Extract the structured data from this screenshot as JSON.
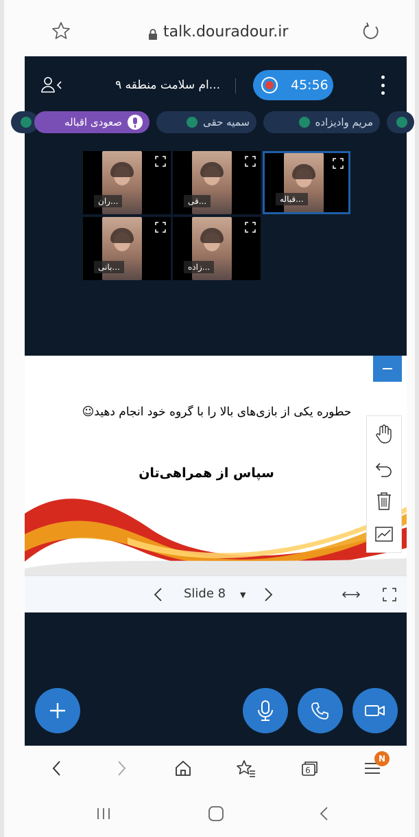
{
  "browser": {
    "url": "talk.douradour.ir"
  },
  "meeting": {
    "room_title": "...ام سلامت منطقه ۹",
    "record_time": "45:56",
    "participants": [
      {
        "name": "صعودی اقباله",
        "active": true
      },
      {
        "name": "سمیه حقی",
        "active": false
      },
      {
        "name": "مریم وادیزاده",
        "active": false
      }
    ],
    "tiles": [
      {
        "label": "...قباله",
        "selected": true
      },
      {
        "label": "...قی",
        "selected": false
      },
      {
        "label": "...ران",
        "selected": false
      },
      {
        "label": "...زاده",
        "selected": false
      },
      {
        "label": "...بانی",
        "selected": false
      }
    ]
  },
  "slide": {
    "text": "حطوره یکی از بازی‌های بالا را با گروه خود انجام دهید☺",
    "heading": "سپاس از همراهی‌تان"
  },
  "slide_nav": {
    "label": "Slide 8"
  },
  "browser_nav": {
    "tabs_count": "6",
    "badge": "N"
  },
  "colors": {
    "dark_bg": "#0d1a2a",
    "accent_blue": "#2a79cc",
    "record_red": "#e0423a",
    "active_chip": "#7a4fb5"
  }
}
